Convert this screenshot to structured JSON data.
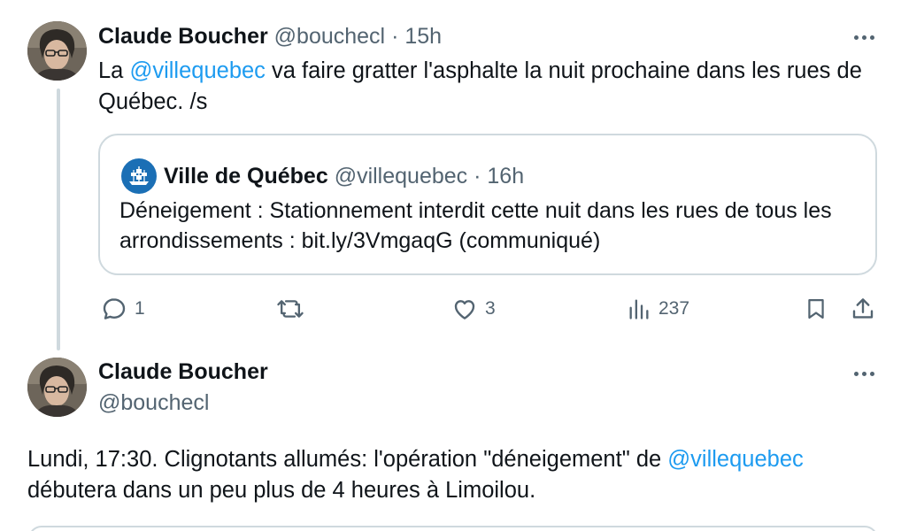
{
  "tweet1": {
    "author_name": "Claude Boucher",
    "author_handle": "@bouchecl",
    "separator": "·",
    "time": "15h",
    "text_before": "La ",
    "mention": "@villequebec",
    "text_after": " va faire gratter l'asphalte la nuit prochaine dans les rues de Québec. /s",
    "quote": {
      "author_name": "Ville de Québec",
      "author_handle": "@villequebec",
      "separator": "·",
      "time": "16h",
      "text": "Déneigement : Stationnement interdit cette nuit dans les rues de tous les arrondissements : bit.ly/3VmgaqG (communiqué)"
    },
    "actions": {
      "reply_count": "1",
      "retweet_count": "",
      "like_count": "3",
      "views_count": "237"
    }
  },
  "tweet2": {
    "author_name": "Claude Boucher",
    "author_handle": "@bouchecl",
    "text_before": "Lundi, 17:30. Clignotants allumés: l'opération \"déneigement\" de ",
    "mention": "@villequebec",
    "text_after": " débutera dans un peu plus de 4 heures à Limoilou."
  },
  "icons": {
    "reply": "reply-icon",
    "retweet": "retweet-icon",
    "like": "heart-icon",
    "views": "views-icon",
    "bookmark": "bookmark-icon",
    "share": "share-icon",
    "more": "more-icon"
  },
  "colors": {
    "link": "#1d9bf0",
    "muted": "#536471",
    "border": "#cfd9de",
    "text": "#0f1419"
  }
}
